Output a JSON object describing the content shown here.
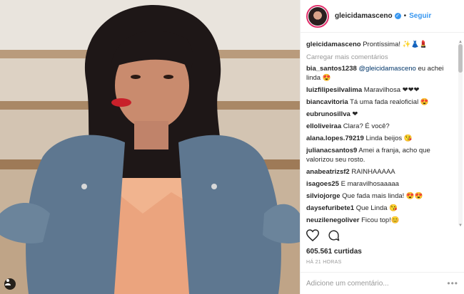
{
  "post": {
    "username": "gleicidamasceno",
    "follow_label": "Seguir",
    "likes": "605.561 curtidas",
    "time": "HÁ 21 HORAS",
    "add_comment_placeholder": "Adicione um comentário...",
    "load_more": "Carregar mais comentários"
  },
  "caption": {
    "user": "gleicidamasceno",
    "text": " Prontíssima! ✨👗💄"
  },
  "comments": [
    {
      "user": "bia_santos1238",
      "mention": "@gleicidamasceno",
      "text": " eu achei linda 😍"
    },
    {
      "user": "luizfilipesilvalima",
      "mention": "",
      "text": " Maravilhosa ❤❤❤"
    },
    {
      "user": "biancavitoria",
      "mention": "",
      "text": " Tá uma fada realoficial 😍"
    },
    {
      "user": "eubrunosillva",
      "mention": "",
      "text": " ❤"
    },
    {
      "user": "elloliveiraa",
      "mention": "",
      "text": " Clara? É você?"
    },
    {
      "user": "alana.lopes.79219",
      "mention": "",
      "text": " Linda beijos 😘"
    },
    {
      "user": "julianacsantos9",
      "mention": "",
      "text": " Amei a franja, acho que valorizou seu rosto."
    },
    {
      "user": "anabeatrizsf2",
      "mention": "",
      "text": " RAINHAAAAA"
    },
    {
      "user": "isagoes25",
      "mention": "",
      "text": " E maravilhosaaaaa"
    },
    {
      "user": "silviojorge",
      "mention": "",
      "text": " Que fada mais linda! 😍😍"
    },
    {
      "user": "daysefuribete1",
      "mention": "",
      "text": " Que Linda 😘"
    },
    {
      "user": "neuzilenegoliver",
      "mention": "",
      "text": " Ficou top!😊"
    }
  ],
  "icons": {
    "verified": "verified-badge-icon",
    "like": "heart-outline-icon",
    "comment": "comment-bubble-icon",
    "more": "more-options-icon",
    "tagged": "person-tag-icon"
  },
  "colors": {
    "link": "#3897f0",
    "mention": "#003569",
    "muted": "#999999",
    "text": "#262626"
  }
}
